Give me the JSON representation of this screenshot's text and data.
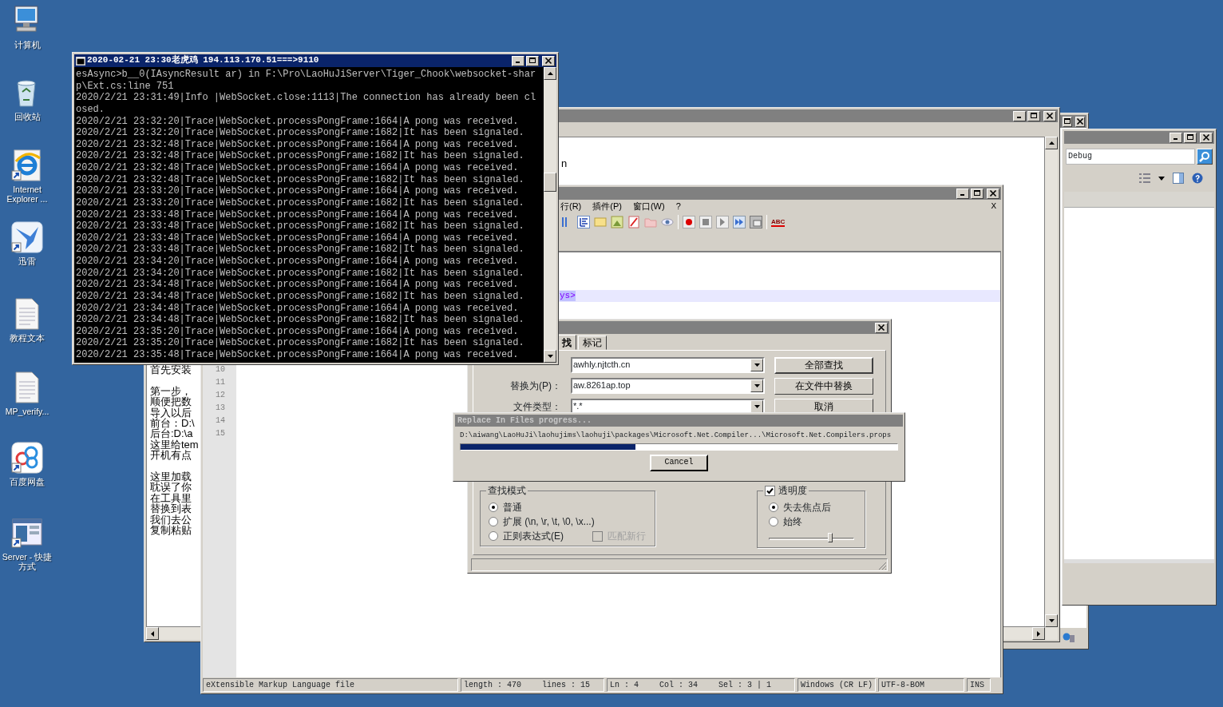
{
  "desktop_icons": [
    {
      "label": "计算机",
      "kind": "computer",
      "shortcut": false
    },
    {
      "label": "回收站",
      "kind": "recycle",
      "shortcut": false
    },
    {
      "label": "Internet Explorer ...",
      "kind": "browser",
      "shortcut": true
    },
    {
      "label": "迅雷",
      "kind": "bird",
      "shortcut": true
    },
    {
      "label": "教程文本",
      "kind": "document",
      "shortcut": false
    },
    {
      "label": "MP_verify...",
      "kind": "document",
      "shortcut": false
    },
    {
      "label": "百度网盘",
      "kind": "cloud",
      "shortcut": true
    },
    {
      "label": "Server - 快捷方式",
      "kind": "server",
      "shortcut": true
    }
  ],
  "explorer": {
    "address": "Debug"
  },
  "text_editor": {
    "fragment": "n",
    "paragraphs": [
      [
        "首先安装"
      ],
      [
        "第一步，",
        "顺便把数",
        "导入以后",
        "前台：D:\\",
        "后台:D:\\a",
        "这里给tem",
        "开机有点"
      ],
      [
        "这里加载",
        "耽误了你",
        "在工具里",
        "替换到表",
        "我们去公",
        "复制粘贴"
      ]
    ]
  },
  "notepadpp": {
    "menu": [
      "行(R)",
      "插件(P)",
      "窗口(W)",
      "?"
    ],
    "close_doc": "X",
    "spellcheck_label": "ABC",
    "highlighted_text": "ys>",
    "line_numbers": [
      "10",
      "11",
      "12",
      "13",
      "14",
      "15"
    ],
    "status_bar": [
      {
        "texts": [
          "eXtensible Markup Language file"
        ]
      },
      {
        "texts": [
          "length : 470",
          "lines : 15"
        ]
      },
      {
        "texts": [
          "Ln : 4",
          "Col : 34",
          "Sel : 3 | 1"
        ]
      },
      {
        "texts": [
          "Windows (CR LF)"
        ]
      },
      {
        "texts": [
          "UTF-8-BOM"
        ]
      },
      {
        "texts": [
          "INS"
        ]
      }
    ]
  },
  "find_dialog": {
    "tabs": [
      {
        "label": "找",
        "selected": true
      },
      {
        "label": "标记",
        "selected": false
      }
    ],
    "fields": [
      {
        "value": "awhly.njtcth.cn"
      },
      {
        "label": "替换为(P)：",
        "value": "aw.8261ap.top"
      },
      {
        "label": "文件类型：",
        "value": "*.*"
      }
    ],
    "buttons": [
      "全部查找",
      "在文件中替换",
      "取消"
    ],
    "search_mode": {
      "title": "查找模式",
      "options": [
        {
          "label": "普通",
          "selected": true
        },
        {
          "label": "扩展 (\\n, \\r, \\t, \\0, \\x...)",
          "selected": false
        },
        {
          "label": "正则表达式(E)",
          "selected": false
        }
      ],
      "match_newline": {
        "label": "匹配新行",
        "checked": false,
        "disabled": true
      }
    },
    "transparency": {
      "label": "透明度",
      "checked": true,
      "options": [
        {
          "label": "失去焦点后",
          "selected": true
        },
        {
          "label": "始终",
          "selected": false
        }
      ],
      "level": 0.72
    }
  },
  "progress_dialog": {
    "title": "Replace In Files progress...",
    "path": "D:\\aiwang\\LaoHuJi\\laohujims\\laohuji\\packages\\Microsoft.Net.Compiler...\\Microsoft.Net.Compilers.props",
    "level": 0.4,
    "button": "Cancel"
  },
  "console": {
    "title": "2020-02-21 23:30老虎鸡 194.113.170.51===>9110",
    "lines": [
      "esAsync>b__0(IAsyncResult ar) in F:\\Pro\\LaoHuJiServer\\Tiger_Chook\\websocket-shar",
      "p\\Ext.cs:line 751",
      "2020/2/21 23:31:49|Info |WebSocket.close:1113|The connection has already been cl",
      "osed.",
      "2020/2/21 23:32:20|Trace|WebSocket.processPongFrame:1664|A pong was received.",
      "2020/2/21 23:32:20|Trace|WebSocket.processPongFrame:1682|It has been signaled.",
      "2020/2/21 23:32:48|Trace|WebSocket.processPongFrame:1664|A pong was received.",
      "2020/2/21 23:32:48|Trace|WebSocket.processPongFrame:1682|It has been signaled.",
      "2020/2/21 23:32:48|Trace|WebSocket.processPongFrame:1664|A pong was received.",
      "2020/2/21 23:32:48|Trace|WebSocket.processPongFrame:1682|It has been signaled.",
      "2020/2/21 23:33:20|Trace|WebSocket.processPongFrame:1664|A pong was received.",
      "2020/2/21 23:33:20|Trace|WebSocket.processPongFrame:1682|It has been signaled.",
      "2020/2/21 23:33:48|Trace|WebSocket.processPongFrame:1664|A pong was received.",
      "2020/2/21 23:33:48|Trace|WebSocket.processPongFrame:1682|It has been signaled.",
      "2020/2/21 23:33:48|Trace|WebSocket.processPongFrame:1664|A pong was received.",
      "2020/2/21 23:33:48|Trace|WebSocket.processPongFrame:1682|It has been signaled.",
      "2020/2/21 23:34:20|Trace|WebSocket.processPongFrame:1664|A pong was received.",
      "2020/2/21 23:34:20|Trace|WebSocket.processPongFrame:1682|It has been signaled.",
      "2020/2/21 23:34:48|Trace|WebSocket.processPongFrame:1664|A pong was received.",
      "2020/2/21 23:34:48|Trace|WebSocket.processPongFrame:1682|It has been signaled.",
      "2020/2/21 23:34:48|Trace|WebSocket.processPongFrame:1664|A pong was received.",
      "2020/2/21 23:34:48|Trace|WebSocket.processPongFrame:1682|It has been signaled.",
      "2020/2/21 23:35:20|Trace|WebSocket.processPongFrame:1664|A pong was received.",
      "2020/2/21 23:35:20|Trace|WebSocket.processPongFrame:1682|It has been signaled.",
      "2020/2/21 23:35:48|Trace|WebSocket.processPongFrame:1664|A pong was received."
    ]
  }
}
